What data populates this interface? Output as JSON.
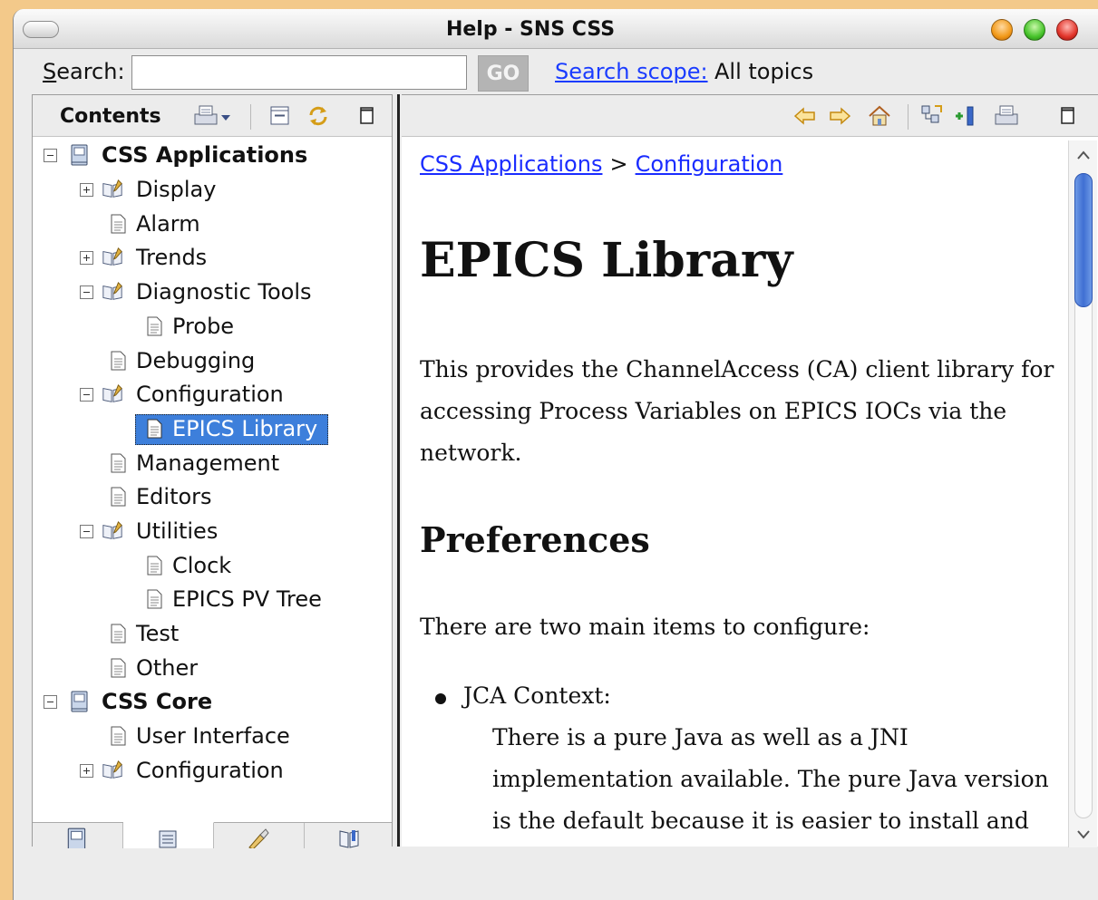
{
  "window": {
    "title": "Help - SNS CSS"
  },
  "search": {
    "label": "Search:",
    "label_accel": "S",
    "label_rest": "earch:",
    "value": "",
    "go_label": "GO",
    "scope_link": "Search scope:",
    "scope_value": "All topics"
  },
  "contents": {
    "title": "Contents",
    "tree": [
      {
        "label": "CSS Applications",
        "level": 0,
        "expander": "minus",
        "icon": "book-blue-icon",
        "bold": true
      },
      {
        "label": "Display",
        "level": 1,
        "expander": "plus",
        "icon": "open-book-icon"
      },
      {
        "label": "Alarm",
        "level": 1,
        "expander": "none",
        "icon": "page-icon"
      },
      {
        "label": "Trends",
        "level": 1,
        "expander": "plus",
        "icon": "open-book-icon"
      },
      {
        "label": "Diagnostic Tools",
        "level": 1,
        "expander": "minus",
        "icon": "open-book-icon"
      },
      {
        "label": "Probe",
        "level": 2,
        "expander": "none",
        "icon": "page-icon"
      },
      {
        "label": "Debugging",
        "level": 1,
        "expander": "none",
        "icon": "page-icon"
      },
      {
        "label": "Configuration",
        "level": 1,
        "expander": "minus",
        "icon": "open-book-icon"
      },
      {
        "label": "EPICS Library",
        "level": 2,
        "expander": "none",
        "icon": "page-icon",
        "selected": true
      },
      {
        "label": "Management",
        "level": 1,
        "expander": "none",
        "icon": "page-icon"
      },
      {
        "label": "Editors",
        "level": 1,
        "expander": "none",
        "icon": "page-icon"
      },
      {
        "label": "Utilities",
        "level": 1,
        "expander": "minus",
        "icon": "open-book-icon"
      },
      {
        "label": "Clock",
        "level": 2,
        "expander": "none",
        "icon": "page-icon"
      },
      {
        "label": "EPICS PV Tree",
        "level": 2,
        "expander": "none",
        "icon": "page-icon"
      },
      {
        "label": "Test",
        "level": 1,
        "expander": "none",
        "icon": "page-icon"
      },
      {
        "label": "Other",
        "level": 1,
        "expander": "none",
        "icon": "page-icon"
      },
      {
        "label": "CSS Core",
        "level": 0,
        "expander": "minus",
        "icon": "book-blue-icon",
        "bold": true
      },
      {
        "label": "User Interface",
        "level": 1,
        "expander": "none",
        "icon": "page-icon"
      },
      {
        "label": "Configuration",
        "level": 1,
        "expander": "plus",
        "icon": "open-book-icon"
      }
    ],
    "tabs": [
      "contents-tab-icon",
      "index-tab-icon",
      "search-tab-icon",
      "bookmarks-tab-icon"
    ]
  },
  "page": {
    "breadcrumb": [
      "CSS Applications",
      "Configuration"
    ],
    "breadcrumb_sep": ">",
    "title": "EPICS Library",
    "intro": "This provides the ChannelAccess (CA) client library for accessing Process Variables on EPICS IOCs via the network.",
    "section_title": "Preferences",
    "section_intro": "There are two main items to configure:",
    "bullet_title": "JCA Context:",
    "bullet_body": "There is a pure Java as well as a JNI implementation available. The pure Java version is the default because it is easier to install and"
  },
  "colors": {
    "link": "#1a2cff",
    "selection": "#3d7fdb",
    "desktop": "#f3c98a"
  }
}
